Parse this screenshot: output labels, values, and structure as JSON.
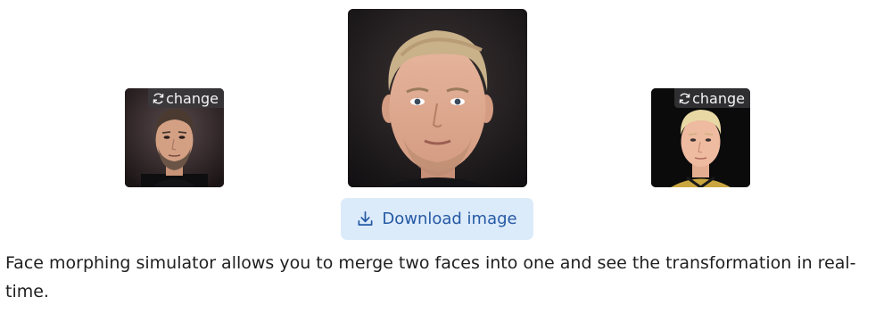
{
  "faces": {
    "left": {
      "change_label": "change",
      "icon": "refresh-icon",
      "subject": "source-face-a"
    },
    "center": {
      "subject": "morphed-face"
    },
    "right": {
      "change_label": "change",
      "icon": "refresh-icon",
      "subject": "source-face-b"
    }
  },
  "download": {
    "label": "Download image",
    "icon": "download-icon"
  },
  "description": {
    "text": "Face morphing simulator allows you to merge two faces into one and see the transformation in real-time."
  },
  "colors": {
    "button_background": "#dcebfa",
    "button_text": "#2559a4",
    "chip_background": "#3a3a3c",
    "body_text": "#1f1f1f"
  }
}
